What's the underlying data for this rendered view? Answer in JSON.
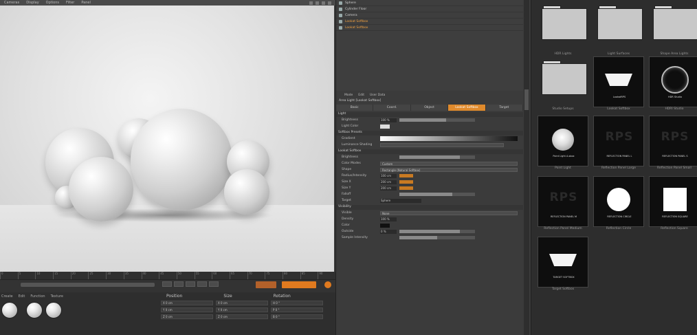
{
  "menubar": {
    "items": [
      "Cameras",
      "Display",
      "Options",
      "Filter",
      "Panel"
    ]
  },
  "timeline": {
    "frames": [
      "0",
      "5",
      "10",
      "15",
      "20",
      "25",
      "30",
      "35",
      "40",
      "45",
      "50",
      "55",
      "60",
      "65",
      "70",
      "75",
      "80",
      "85",
      "90"
    ]
  },
  "material_manager": {
    "menu": [
      "Create",
      "Edit",
      "Function",
      "Texture"
    ]
  },
  "coordinates": {
    "headers": [
      "Position",
      "Size",
      "Rotation"
    ],
    "rows": [
      [
        "X 0 cm",
        "X 0 cm",
        "H 0 °"
      ],
      [
        "Y 0 cm",
        "Y 0 cm",
        "P 0 °"
      ],
      [
        "Z 0 cm",
        "Z 0 cm",
        "B 0 °"
      ]
    ]
  },
  "objects": [
    {
      "name": "Sphere"
    },
    {
      "name": "Cylinder Floor"
    },
    {
      "name": "Camera"
    },
    {
      "name": "Lookat Softbox"
    },
    {
      "name": "Lookat Softbox"
    }
  ],
  "attributes": {
    "menu": [
      "Mode",
      "Edit",
      "User Data"
    ],
    "title": "Area Light [Lookat Softbox]",
    "tabs": [
      "Basic",
      "Coord.",
      "Object",
      "Lookat Softbox",
      "Target"
    ],
    "sections": {
      "light": "Light",
      "preset": "Softbox Presets",
      "projection": "Lookat Softbox",
      "target": "Target",
      "visibility": "Visibility"
    },
    "labels": {
      "brightness": "Brightness",
      "light_color": "Light Color",
      "gradient": "Gradient",
      "reset": "Luminance Shading",
      "color_mode": "Color Modes",
      "shape": "Shape",
      "radius": "Radius/Intensity",
      "size_x": "Size X",
      "size_y": "Size Y",
      "falloff": "Falloff",
      "target": "Target",
      "visible": "Visible",
      "density": "Density",
      "color": "Color",
      "outside": "Outside",
      "additive": "Sample Intensity"
    },
    "values": {
      "brightness": "100 %",
      "radius": "100 cm",
      "size_x": "200 cm",
      "size_y": "200 cm",
      "density": "100 %",
      "outside": "0 %"
    },
    "fills": {
      "brightness": 0.62,
      "radius": 0.2,
      "size_x": 0.2,
      "size_y": 0.2,
      "falloff": 0.7,
      "outside": 0.8,
      "additive": 0.5
    },
    "dropdowns": {
      "color_mode": "Custom",
      "shape": "Rectangle (Natural Softbox)",
      "visible": "None",
      "target": "Sphere"
    }
  },
  "presets": [
    {
      "caption": "HDR Lights",
      "kind": "folder"
    },
    {
      "caption": "Light Surfaces",
      "kind": "folder"
    },
    {
      "caption": "Shape Area Lights",
      "kind": "folder"
    },
    {
      "caption": "Studio Setups",
      "kind": "folder"
    },
    {
      "caption": "Lookat Softbox",
      "kind": "softbox",
      "label": "LookatRPS"
    },
    {
      "caption": "HDRI Studio",
      "kind": "ring",
      "label": "HDR Studio"
    },
    {
      "caption": "Point Light",
      "kind": "dot",
      "label": "Point Light A.sbox"
    },
    {
      "caption": "Reflection Panel Large",
      "kind": "rps",
      "label": "REFLECTION PANEL L"
    },
    {
      "caption": "Reflection Panel Small",
      "kind": "rps",
      "label": "REFLECTION PANEL S"
    },
    {
      "caption": "Reflection Panel Medium",
      "kind": "rps",
      "label": "REFLECTION PANEL M"
    },
    {
      "caption": "Reflection Circle",
      "kind": "circle",
      "label": "REFLECTION CIRCLE"
    },
    {
      "caption": "Reflection Square",
      "kind": "square",
      "label": "REFLECTION SQUARE"
    },
    {
      "caption": "Target Softbox",
      "kind": "softbox",
      "label": "TARGET SOFTBOX"
    }
  ]
}
